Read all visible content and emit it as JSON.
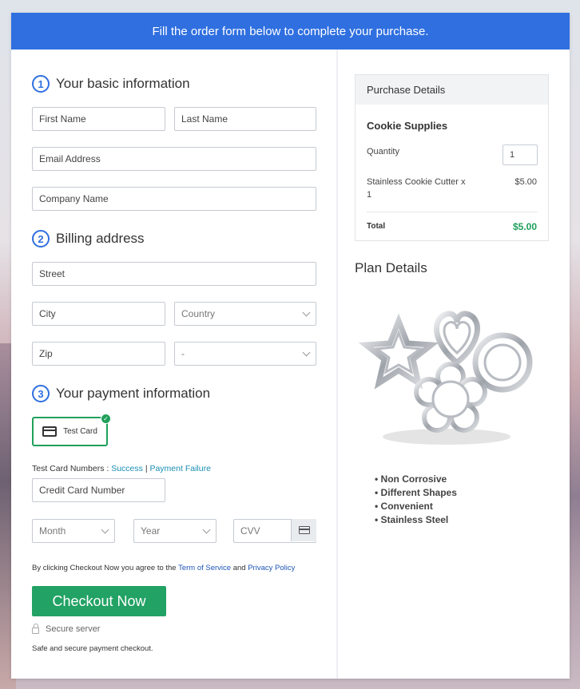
{
  "banner": {
    "text": "Fill the order form below to complete your purchase."
  },
  "basic_info": {
    "step": "1",
    "title": "Your basic information",
    "first_name_placeholder": "First Name",
    "last_name_placeholder": "Last Name",
    "email_placeholder": "Email Address",
    "company_placeholder": "Company Name"
  },
  "billing": {
    "step": "2",
    "title": "Billing address",
    "street_placeholder": "Street",
    "city_placeholder": "City",
    "country_selected": "Country",
    "zip_placeholder": "Zip",
    "state_selected": "-"
  },
  "payment": {
    "step": "3",
    "title": "Your payment information",
    "test_card_label": "Test Card",
    "test_numbers_label": "Test Card Numbers :",
    "success_link": "Success",
    "separator": "|",
    "failure_link": "Payment Failure",
    "card_number_placeholder": "Credit Card Number",
    "month_selected": "Month",
    "year_selected": "Year",
    "cvv_placeholder": "CVV",
    "agree_prefix": "By clicking Checkout Now you agree to the",
    "terms_link": "Term of Service",
    "and_text": "and",
    "privacy_link": "Privacy Policy",
    "checkout_button": "Checkout Now",
    "secure_server": "Secure server",
    "safe_text": "Safe and secure payment checkout."
  },
  "purchase_details": {
    "title": "Purchase Details",
    "product_name": "Cookie Supplies",
    "quantity_label": "Quantity",
    "quantity_value": "1",
    "item_line1": "Stainless Cookie Cutter x",
    "item_line2": "1",
    "item_price": "$5.00",
    "total_label": "Total",
    "total_value": "$5.00"
  },
  "plan": {
    "title": "Plan Details",
    "features": [
      "Non Corrosive",
      "Different Shapes",
      "Convenient",
      "Stainless Steel"
    ]
  },
  "colors": {
    "accent": "#2f6fe0",
    "button": "#22a264",
    "total": "#1fa05a"
  }
}
